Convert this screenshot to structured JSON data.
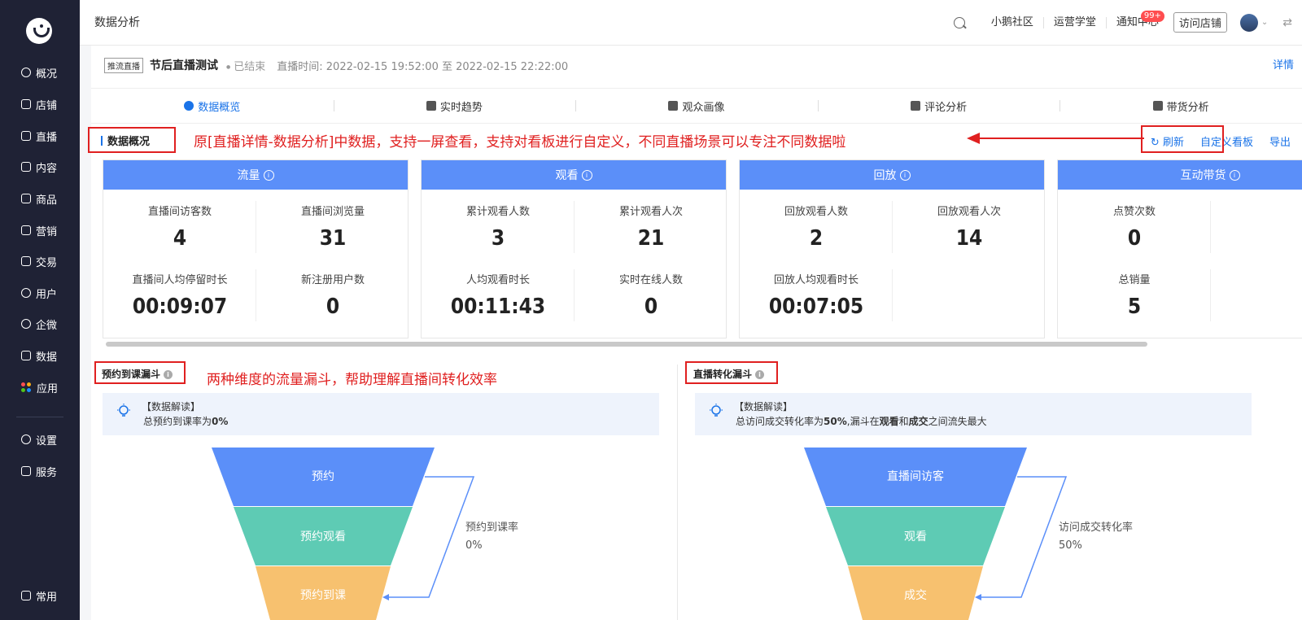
{
  "sidebar": {
    "items": [
      {
        "label": "概况",
        "icon": "pie-chart-icon"
      },
      {
        "label": "店铺",
        "icon": "store-icon"
      },
      {
        "label": "直播",
        "icon": "live-icon"
      },
      {
        "label": "内容",
        "icon": "document-icon"
      },
      {
        "label": "商品",
        "icon": "bag-icon"
      },
      {
        "label": "营销",
        "icon": "megaphone-icon"
      },
      {
        "label": "交易",
        "icon": "transaction-icon"
      },
      {
        "label": "用户",
        "icon": "user-icon"
      },
      {
        "label": "企微",
        "icon": "wecom-icon"
      },
      {
        "label": "数据",
        "icon": "data-icon"
      },
      {
        "label": "应用",
        "icon": "apps-icon"
      }
    ],
    "bottom_items": [
      {
        "label": "设置",
        "icon": "gear-icon"
      },
      {
        "label": "服务",
        "icon": "service-icon"
      }
    ],
    "footer": {
      "label": "常用",
      "icon": "list-icon"
    }
  },
  "topbar": {
    "page_title": "数据分析",
    "links": [
      "小鹅社区",
      "运营学堂",
      "通知中心"
    ],
    "notification_badge": "99+",
    "store_button": "访问店铺"
  },
  "live": {
    "tag": "推流直播",
    "title": "节后直播测试",
    "status": "已结束",
    "time_range": "直播时间: 2022-02-15 19:52:00 至 2022-02-15 22:22:00",
    "detail_link": "详情"
  },
  "tabs": [
    {
      "label": "数据概览",
      "active": true
    },
    {
      "label": "实时趋势",
      "active": false
    },
    {
      "label": "观众画像",
      "active": false
    },
    {
      "label": "评论分析",
      "active": false
    },
    {
      "label": "带货分析",
      "active": false
    }
  ],
  "overview": {
    "title": "数据概况",
    "annotation": "原[直播详情-数据分析]中数据，支持一屏查看，支持对看板进行自定义，不同直播场景可以专注不同数据啦",
    "actions": {
      "refresh": "刷新",
      "customize": "自定义看板",
      "export": "导出"
    },
    "cards": [
      {
        "title": "流量",
        "metrics": [
          {
            "label": "直播间访客数",
            "value": "4"
          },
          {
            "label": "直播间浏览量",
            "value": "31"
          },
          {
            "label": "直播间人均停留时长",
            "value": "00:09:07"
          },
          {
            "label": "新注册用户数",
            "value": "0"
          }
        ]
      },
      {
        "title": "观看",
        "metrics": [
          {
            "label": "累计观看人数",
            "value": "3"
          },
          {
            "label": "累计观看人次",
            "value": "21"
          },
          {
            "label": "人均观看时长",
            "value": "00:11:43"
          },
          {
            "label": "实时在线人数",
            "value": "0"
          }
        ]
      },
      {
        "title": "回放",
        "metrics": [
          {
            "label": "回放观看人数",
            "value": "2"
          },
          {
            "label": "回放观看人次",
            "value": "14"
          },
          {
            "label": "回放人均观看时长",
            "value": "00:07:05"
          }
        ]
      },
      {
        "title": "互动带货",
        "metrics": [
          {
            "label": "点赞次数",
            "value": "0"
          },
          {
            "label": "总销量",
            "value": "5"
          }
        ]
      }
    ]
  },
  "funnel_left": {
    "title": "预约到课漏斗",
    "annotation": "两种维度的流量漏斗，帮助理解直播间转化效率",
    "read_title": "【数据解读】",
    "read_text_prefix": "总预约到课率为",
    "read_value": "0%",
    "stages": [
      "预约",
      "预约观看",
      "预约到课"
    ],
    "rate_label": "预约到课率",
    "rate_value": "0%",
    "colors": [
      "#5b8ff9",
      "#5ad8a6",
      "#f6bd16"
    ]
  },
  "funnel_right": {
    "title": "直播转化漏斗",
    "read_title": "【数据解读】",
    "read_text_a": "总访问成交转化率为",
    "read_value": "50%",
    "read_text_b": ",漏斗在",
    "read_bold1": "观看",
    "read_text_c": "和",
    "read_bold2": "成交",
    "read_text_d": "之间流失最大",
    "stages": [
      "直播间访客",
      "观看",
      "成交"
    ],
    "rate_label": "访问成交转化率",
    "rate_value": "50%"
  }
}
